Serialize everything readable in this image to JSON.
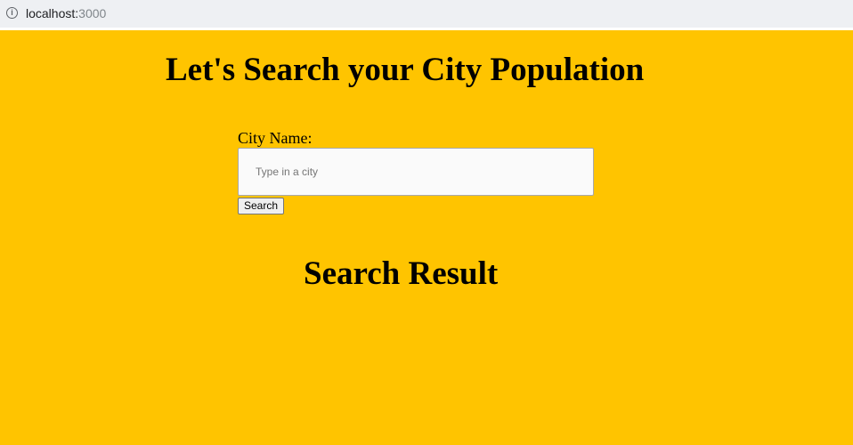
{
  "browser": {
    "url_host": "localhost:",
    "url_port": "3000",
    "info_icon": "info-icon"
  },
  "page": {
    "background_color": "#ffc400",
    "title": "Let's Search your City Population",
    "field_label": "City Name:",
    "city_input": {
      "value": "",
      "placeholder": "Type in a city"
    },
    "search_button_label": "Search",
    "result_title": "Search Result"
  }
}
